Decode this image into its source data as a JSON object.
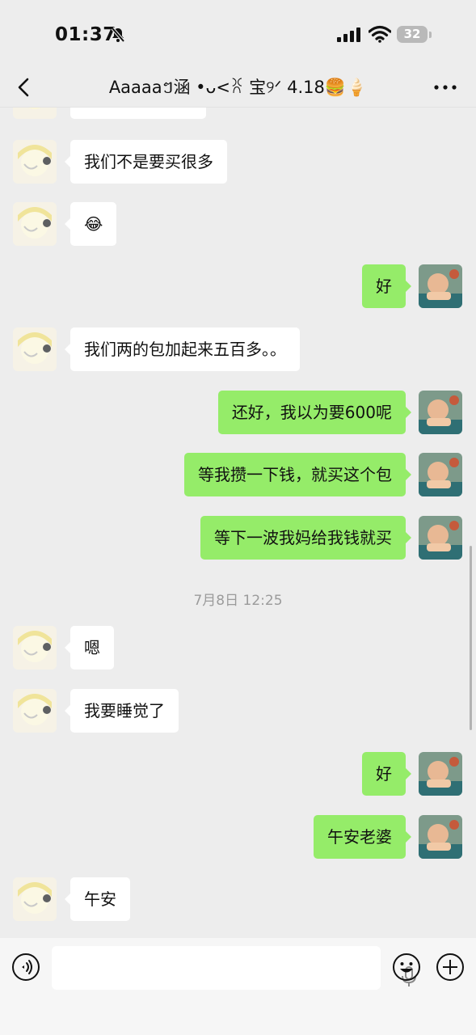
{
  "status": {
    "time": "01:37",
    "battery": "32"
  },
  "header": {
    "title": "Aaaaaៗ涵 •ᴗ<ꐦ 宝୨ᐟ 4.18🍔🍦"
  },
  "messages": [
    {
      "side": "left",
      "text": "我们不是要买很多"
    },
    {
      "side": "left",
      "text": "😂"
    },
    {
      "side": "right",
      "text": "好"
    },
    {
      "side": "left",
      "text": "我们两的包加起来五百多。。"
    },
    {
      "side": "right",
      "text": "还好，我以为要600呢"
    },
    {
      "side": "right",
      "text": "等我攒一下钱，就买这个包"
    },
    {
      "side": "right",
      "text": "等下一波我妈给我钱就买"
    },
    {
      "side": "timestamp",
      "text": "7月8日 12:25"
    },
    {
      "side": "left",
      "text": "嗯"
    },
    {
      "side": "left",
      "text": "我要睡觉了"
    },
    {
      "side": "right",
      "text": "好"
    },
    {
      "side": "right",
      "text": "午安老婆"
    },
    {
      "side": "left",
      "text": "午安"
    }
  ],
  "colors": {
    "own_bubble": "#95ec69",
    "other_bubble": "#ffffff",
    "background": "#ededed"
  },
  "icons": [
    "back-icon",
    "more-icon",
    "voice-icon",
    "mic-icon",
    "emoji-icon",
    "plus-icon",
    "bell-slash-icon",
    "signal-icon",
    "wifi-icon"
  ]
}
